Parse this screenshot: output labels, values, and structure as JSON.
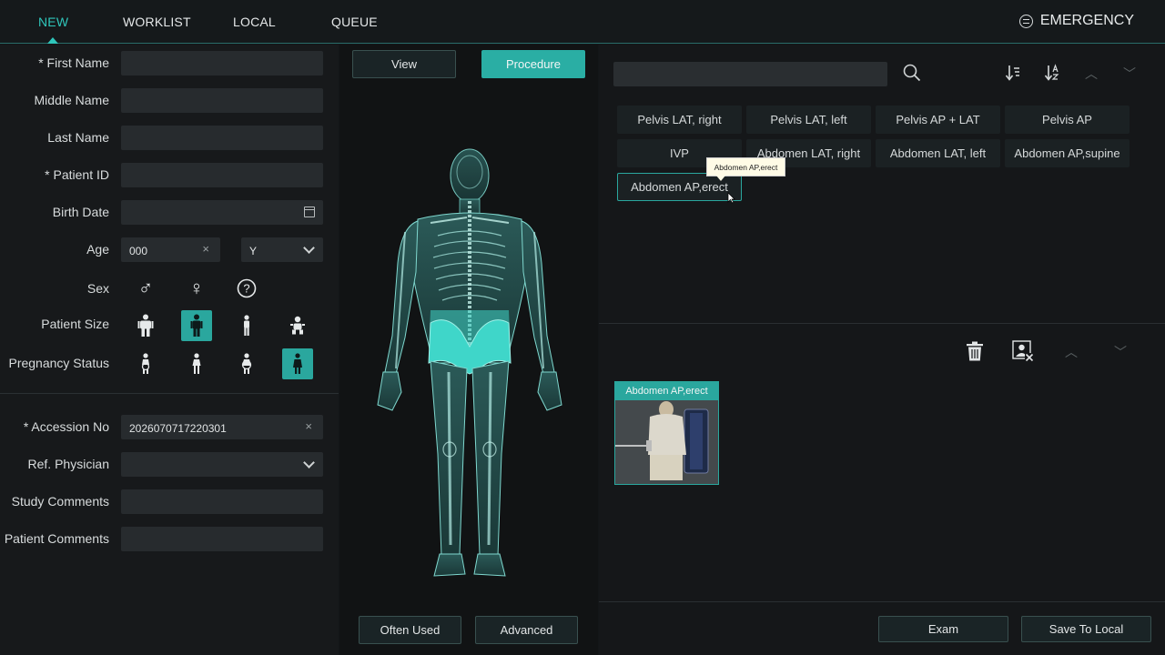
{
  "nav": {
    "tabs": [
      {
        "label": "NEW",
        "active": true
      },
      {
        "label": "WORKLIST",
        "active": false
      },
      {
        "label": "LOCAL",
        "active": false
      },
      {
        "label": "QUEUE",
        "active": false
      }
    ],
    "emergency_label": "EMERGENCY"
  },
  "patient_form": {
    "first_name": {
      "label": "* First Name",
      "value": ""
    },
    "middle_name": {
      "label": "Middle Name",
      "value": ""
    },
    "last_name": {
      "label": "Last Name",
      "value": ""
    },
    "patient_id": {
      "label": "* Patient ID",
      "value": ""
    },
    "birth_date": {
      "label": "Birth Date",
      "value": ""
    },
    "age": {
      "label": "Age",
      "value": "000",
      "unit": "Y"
    },
    "sex": {
      "label": "Sex",
      "options": [
        "male-icon",
        "female-icon",
        "unknown-icon"
      ]
    },
    "patient_size": {
      "label": "Patient Size",
      "options": [
        "adult-large-icon",
        "adult-medium-icon",
        "adult-small-icon",
        "child-icon"
      ],
      "selected_index": 1
    },
    "pregnancy_status": {
      "label": "Pregnancy Status",
      "options": [
        "not-pregnant-icon",
        "possibly-pregnant-icon",
        "pregnant-icon",
        "unknown-pregnancy-icon"
      ],
      "selected_index": 3
    },
    "accession_no": {
      "label": "* Accession No",
      "value": "2026070717220301"
    },
    "ref_physician": {
      "label": "Ref. Physician",
      "value": ""
    },
    "study_comments": {
      "label": "Study Comments",
      "value": ""
    },
    "patient_comments": {
      "label": "Patient Comments",
      "value": ""
    }
  },
  "body_selector": {
    "view_label": "View",
    "procedure_label": "Procedure",
    "often_used_label": "Often Used",
    "advanced_label": "Advanced",
    "highlight_color": "#3fd6c9"
  },
  "procedures": {
    "search_value": "",
    "items": [
      "Pelvis LAT, right",
      "Pelvis LAT, left",
      "Pelvis AP + LAT",
      "Pelvis AP",
      "IVP",
      "Abdomen LAT, right",
      "Abdomen LAT, left",
      "Abdomen AP,supine",
      "Abdomen AP,erect"
    ],
    "selected_index": 8,
    "tooltip": "Abdomen AP,erect"
  },
  "selected_protocols": {
    "items": [
      {
        "title": "Abdomen AP,erect"
      }
    ]
  },
  "footer": {
    "exam_label": "Exam",
    "save_label": "Save To Local"
  },
  "colors": {
    "accent": "#2aa79e",
    "background": "#131618"
  }
}
